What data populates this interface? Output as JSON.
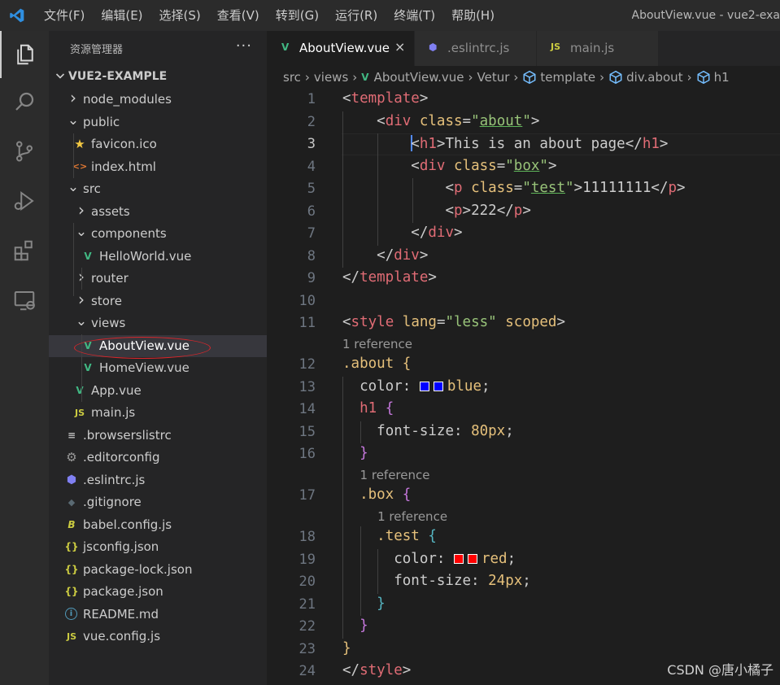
{
  "window": {
    "menu": [
      "文件(F)",
      "编辑(E)",
      "选择(S)",
      "查看(V)",
      "转到(G)",
      "运行(R)",
      "终端(T)",
      "帮助(H)"
    ],
    "title": "AboutView.vue - vue2-exa"
  },
  "colors": {
    "accent": "#528bff",
    "vue_green": "#41b883",
    "selection_oval": "#d9262b"
  },
  "activity_icons": [
    "explorer-icon",
    "search-icon",
    "source-control-icon",
    "run-debug-icon",
    "extensions-icon",
    "remote-explorer-icon"
  ],
  "sidebar": {
    "title": "资源管理器",
    "more": "···",
    "project": "VUE2-EXAMPLE",
    "tree": [
      {
        "label": "node_modules",
        "kind": "folder-closed",
        "icon": "chevron-right-icon"
      },
      {
        "label": "public",
        "kind": "folder-open",
        "icon": "chevron-down-icon"
      },
      {
        "label": "favicon.ico",
        "kind": "file",
        "icon": "star-icon"
      },
      {
        "label": "index.html",
        "kind": "file",
        "icon": "html-icon"
      },
      {
        "label": "src",
        "kind": "folder-open",
        "icon": "chevron-down-icon"
      },
      {
        "label": "assets",
        "kind": "folder-closed",
        "icon": "chevron-right-icon"
      },
      {
        "label": "components",
        "kind": "folder-open",
        "icon": "chevron-down-icon"
      },
      {
        "label": "HelloWorld.vue",
        "kind": "file",
        "icon": "vue-icon"
      },
      {
        "label": "router",
        "kind": "folder-closed",
        "icon": "chevron-right-icon"
      },
      {
        "label": "store",
        "kind": "folder-closed",
        "icon": "chevron-right-icon"
      },
      {
        "label": "views",
        "kind": "folder-open",
        "icon": "chevron-down-icon"
      },
      {
        "label": "AboutView.vue",
        "kind": "file",
        "icon": "vue-icon",
        "selected": true
      },
      {
        "label": "HomeView.vue",
        "kind": "file",
        "icon": "vue-icon"
      },
      {
        "label": "App.vue",
        "kind": "file",
        "icon": "vue-icon"
      },
      {
        "label": "main.js",
        "kind": "file",
        "icon": "js-icon"
      },
      {
        "label": ".browserslistrc",
        "kind": "file",
        "icon": "config-file-icon"
      },
      {
        "label": ".editorconfig",
        "kind": "file",
        "icon": "gear-icon"
      },
      {
        "label": ".eslintrc.js",
        "kind": "file",
        "icon": "eslint-icon"
      },
      {
        "label": ".gitignore",
        "kind": "file",
        "icon": "git-icon"
      },
      {
        "label": "babel.config.js",
        "kind": "file",
        "icon": "babel-icon"
      },
      {
        "label": "jsconfig.json",
        "kind": "file",
        "icon": "json-icon"
      },
      {
        "label": "package-lock.json",
        "kind": "file",
        "icon": "json-icon"
      },
      {
        "label": "package.json",
        "kind": "file",
        "icon": "json-icon"
      },
      {
        "label": "README.md",
        "kind": "file",
        "icon": "info-icon"
      },
      {
        "label": "vue.config.js",
        "kind": "file",
        "icon": "js-icon"
      }
    ]
  },
  "tabs": [
    {
      "label": "AboutView.vue",
      "icon": "vue-icon",
      "active": true,
      "close": "×"
    },
    {
      "label": ".eslintrc.js",
      "icon": "eslint-icon",
      "active": false
    },
    {
      "label": "main.js",
      "icon": "js-icon",
      "active": false
    }
  ],
  "glyphs": {
    "vue": "V",
    "js": "JS",
    "json": "{}",
    "html": "<>",
    "star": "★",
    "babel": "B",
    "info": "i",
    "config": "≡",
    "gear": "⚙",
    "eslint": "⬢",
    "git": "◆",
    "chevron_right": "›",
    "chevron_down": "⌄"
  },
  "breadcrumb": [
    "src",
    "views",
    "AboutView.vue",
    "Vetur",
    "template",
    "div.about",
    "h1"
  ],
  "editor": {
    "current_line": 3,
    "codelens": [
      {
        "text": "1 reference",
        "after_line": 11
      },
      {
        "text": "1 reference",
        "after_line": 16
      },
      {
        "text": "1 reference",
        "after_line": 17
      }
    ],
    "lines": [
      {
        "n": "1",
        "indent": 0,
        "tokens": [
          [
            "<",
            "bracket"
          ],
          [
            "template",
            "tag"
          ],
          [
            ">",
            "bracket"
          ]
        ]
      },
      {
        "n": "2",
        "indent": 1,
        "tokens": [
          [
            "<",
            "bracket"
          ],
          [
            "div",
            "tag"
          ],
          [
            " ",
            "txt"
          ],
          [
            "class",
            "attr"
          ],
          [
            "=",
            "punct"
          ],
          [
            "\"",
            "str"
          ],
          [
            "about",
            "str underline"
          ],
          [
            "\"",
            "str"
          ],
          [
            ">",
            "bracket"
          ]
        ]
      },
      {
        "n": "3",
        "indent": 2,
        "cursor": true,
        "tokens": [
          [
            "<",
            "bracket"
          ],
          [
            "h1",
            "tag"
          ],
          [
            ">",
            "bracket"
          ],
          [
            "This is an about page",
            "txt"
          ],
          [
            "</",
            "bracket"
          ],
          [
            "h1",
            "tag"
          ],
          [
            ">",
            "bracket"
          ]
        ]
      },
      {
        "n": "4",
        "indent": 2,
        "tokens": [
          [
            "<",
            "bracket"
          ],
          [
            "div",
            "tag"
          ],
          [
            " ",
            "txt"
          ],
          [
            "class",
            "attr"
          ],
          [
            "=",
            "punct"
          ],
          [
            "\"",
            "str"
          ],
          [
            "box",
            "str underline"
          ],
          [
            "\"",
            "str"
          ],
          [
            ">",
            "bracket"
          ]
        ]
      },
      {
        "n": "5",
        "indent": 3,
        "tokens": [
          [
            "<",
            "bracket"
          ],
          [
            "p",
            "tag"
          ],
          [
            " ",
            "txt"
          ],
          [
            "class",
            "attr"
          ],
          [
            "=",
            "punct"
          ],
          [
            "\"",
            "str"
          ],
          [
            "test",
            "str underline"
          ],
          [
            "\"",
            "str"
          ],
          [
            ">",
            "bracket"
          ],
          [
            "11111111",
            "txt"
          ],
          [
            "</",
            "bracket"
          ],
          [
            "p",
            "tag"
          ],
          [
            ">",
            "bracket"
          ]
        ]
      },
      {
        "n": "6",
        "indent": 3,
        "tokens": [
          [
            "<",
            "bracket"
          ],
          [
            "p",
            "tag"
          ],
          [
            ">",
            "bracket"
          ],
          [
            "222",
            "txt"
          ],
          [
            "</",
            "bracket"
          ],
          [
            "p",
            "tag"
          ],
          [
            ">",
            "bracket"
          ]
        ]
      },
      {
        "n": "7",
        "indent": 2,
        "tokens": [
          [
            "</",
            "bracket"
          ],
          [
            "div",
            "tag"
          ],
          [
            ">",
            "bracket"
          ]
        ]
      },
      {
        "n": "8",
        "indent": 1,
        "tokens": [
          [
            "</",
            "bracket"
          ],
          [
            "div",
            "tag"
          ],
          [
            ">",
            "bracket"
          ]
        ]
      },
      {
        "n": "9",
        "indent": 0,
        "tokens": [
          [
            "</",
            "bracket"
          ],
          [
            "template",
            "tag"
          ],
          [
            ">",
            "bracket"
          ]
        ]
      },
      {
        "n": "10",
        "indent": 0,
        "tokens": []
      },
      {
        "n": "11",
        "indent": 0,
        "tokens": [
          [
            "<",
            "bracket"
          ],
          [
            "style",
            "tag"
          ],
          [
            " ",
            "txt"
          ],
          [
            "lang",
            "attr"
          ],
          [
            "=",
            "punct"
          ],
          [
            "\"less\"",
            "str"
          ],
          [
            " ",
            "txt"
          ],
          [
            "scoped",
            "attr"
          ],
          [
            ">",
            "bracket"
          ]
        ]
      },
      {
        "n": "12",
        "indent": 0,
        "tokens": [
          [
            ".about",
            "selector"
          ],
          [
            " ",
            "txt"
          ],
          [
            "{",
            "b1"
          ]
        ]
      },
      {
        "n": "13",
        "indent": 1,
        "css": true,
        "tokens": [
          [
            "color",
            "prop"
          ],
          [
            ": ",
            "punct"
          ],
          [
            "#0000ff",
            "swatch"
          ],
          [
            "#0000ff",
            "swatch"
          ],
          [
            "blue",
            "val"
          ],
          [
            ";",
            "punct"
          ]
        ]
      },
      {
        "n": "14",
        "indent": 1,
        "css": true,
        "tokens": [
          [
            "h1",
            "tag"
          ],
          [
            " ",
            "txt"
          ],
          [
            "{",
            "b2"
          ]
        ]
      },
      {
        "n": "15",
        "indent": 2,
        "css": true,
        "tokens": [
          [
            "font-size",
            "prop"
          ],
          [
            ": ",
            "punct"
          ],
          [
            "80px",
            "num"
          ],
          [
            ";",
            "punct"
          ]
        ]
      },
      {
        "n": "16",
        "indent": 1,
        "css": true,
        "tokens": [
          [
            "}",
            "b2"
          ]
        ]
      },
      {
        "n": "17",
        "indent": 1,
        "css": true,
        "tokens": [
          [
            ".box",
            "selector"
          ],
          [
            " ",
            "txt"
          ],
          [
            "{",
            "b2"
          ]
        ]
      },
      {
        "n": "18",
        "indent": 2,
        "css": true,
        "tokens": [
          [
            ".test",
            "selector"
          ],
          [
            " ",
            "txt"
          ],
          [
            "{",
            "b3"
          ]
        ]
      },
      {
        "n": "19",
        "indent": 3,
        "css": true,
        "tokens": [
          [
            "color",
            "prop"
          ],
          [
            ": ",
            "punct"
          ],
          [
            "#ff0000",
            "swatch"
          ],
          [
            "#ff0000",
            "swatch"
          ],
          [
            "red",
            "val"
          ],
          [
            ";",
            "punct"
          ]
        ]
      },
      {
        "n": "20",
        "indent": 3,
        "css": true,
        "tokens": [
          [
            "font-size",
            "prop"
          ],
          [
            ": ",
            "punct"
          ],
          [
            "24px",
            "num"
          ],
          [
            ";",
            "punct"
          ]
        ]
      },
      {
        "n": "21",
        "indent": 2,
        "css": true,
        "tokens": [
          [
            "}",
            "b3"
          ]
        ]
      },
      {
        "n": "22",
        "indent": 1,
        "css": true,
        "tokens": [
          [
            "}",
            "b2"
          ]
        ]
      },
      {
        "n": "23",
        "indent": 0,
        "tokens": [
          [
            "}",
            "b1"
          ]
        ]
      },
      {
        "n": "24",
        "indent": 0,
        "tokens": [
          [
            "</",
            "bracket"
          ],
          [
            "style",
            "tag"
          ],
          [
            ">",
            "bracket"
          ]
        ]
      }
    ]
  },
  "watermark": "CSDN @唐小橘子"
}
